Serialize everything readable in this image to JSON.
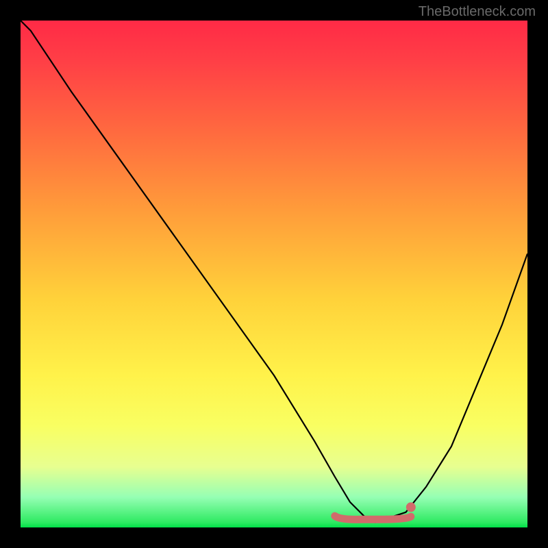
{
  "watermark": "TheBottleneck.com",
  "chart_data": {
    "type": "line",
    "title": "",
    "xlabel": "",
    "ylabel": "",
    "xlim": [
      0,
      100
    ],
    "ylim": [
      0,
      100
    ],
    "series": [
      {
        "name": "curve",
        "color": "#000000",
        "x": [
          0,
          2,
          10,
          20,
          30,
          40,
          50,
          58,
          62,
          65,
          68,
          70,
          73,
          76,
          80,
          85,
          90,
          95,
          100
        ],
        "y": [
          100,
          98,
          86,
          72,
          58,
          44,
          30,
          17,
          10,
          5,
          2,
          1,
          2,
          3,
          8,
          16,
          28,
          40,
          54
        ]
      }
    ],
    "flat_segment": {
      "color": "#d16b6b",
      "x_start": 62,
      "x_end": 77,
      "y": 2,
      "end_dot_x": 77,
      "end_dot_y": 4
    }
  }
}
